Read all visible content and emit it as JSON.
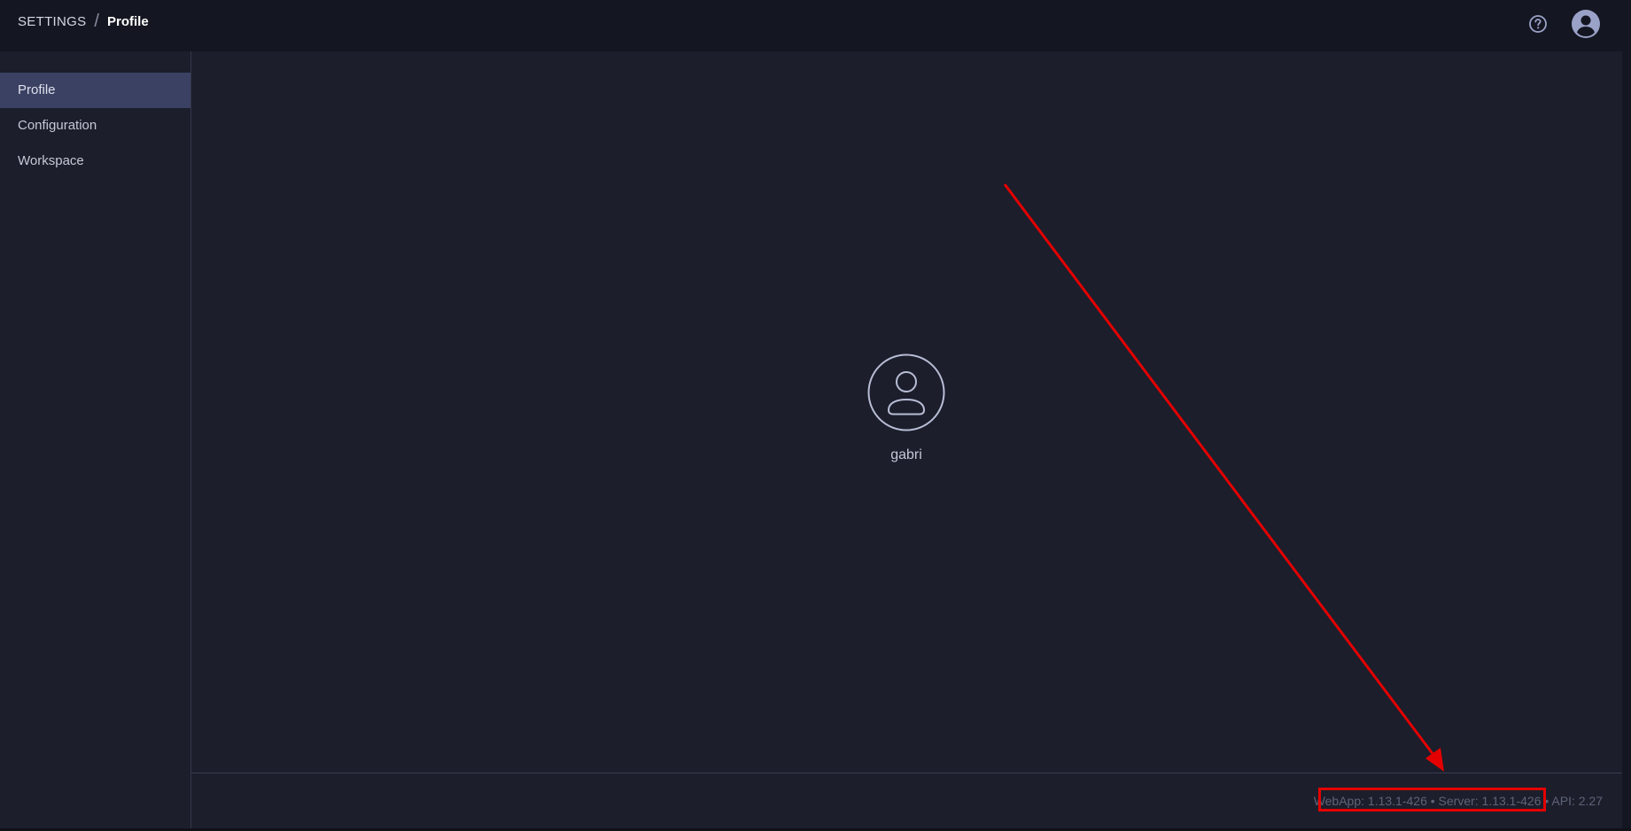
{
  "header": {
    "breadcrumb_root": "SETTINGS",
    "breadcrumb_separator": "/",
    "breadcrumb_current": "Profile",
    "help_icon": "help-circle-icon",
    "avatar_icon": "account-circle-icon"
  },
  "sidebar": {
    "items": [
      {
        "label": "Profile",
        "active": true
      },
      {
        "label": "Configuration",
        "active": false
      },
      {
        "label": "Workspace",
        "active": false
      }
    ]
  },
  "profile": {
    "username": "gabri",
    "avatar_icon": "user-outline-icon"
  },
  "footer": {
    "version": "WebApp: 1.13.1-426 • Server: 1.13.1-426 • API: 2.27"
  },
  "annotation": {
    "color": "#e40000"
  }
}
